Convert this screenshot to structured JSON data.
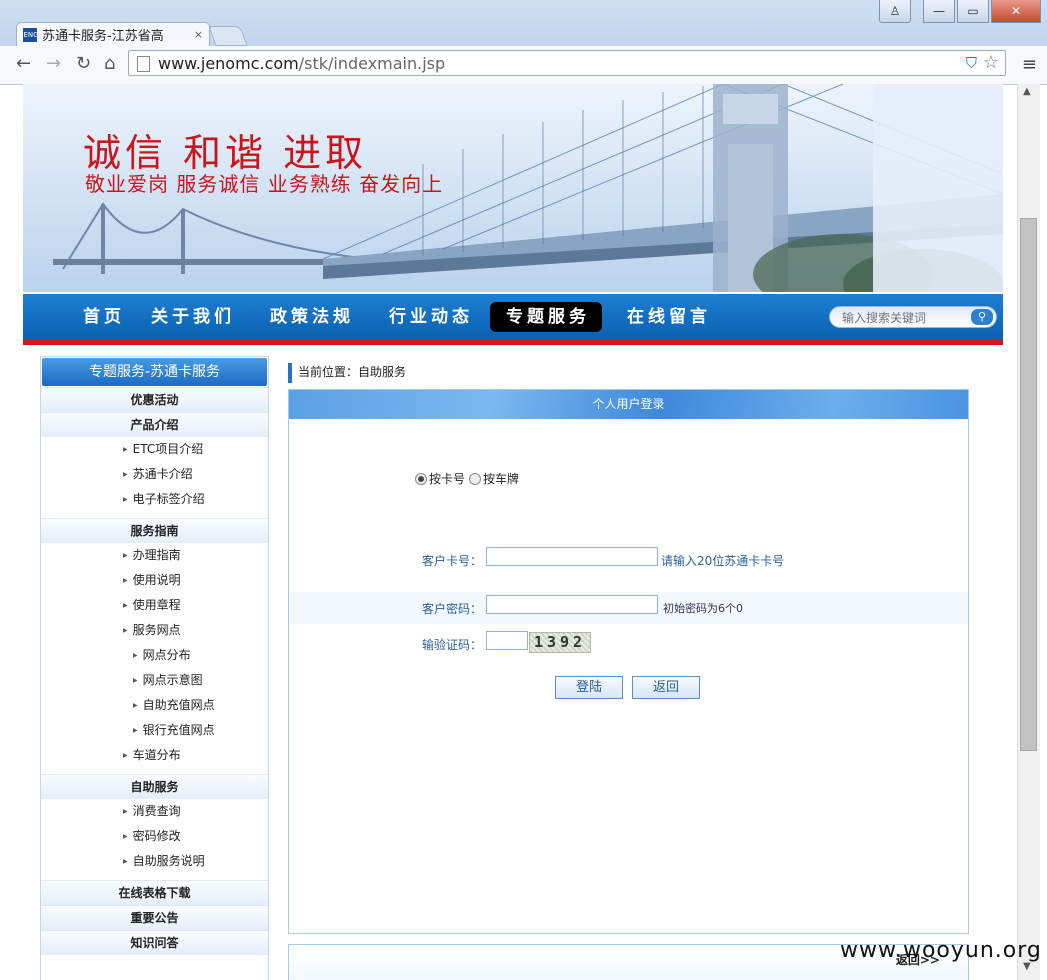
{
  "browser": {
    "tab_title": "苏通卡服务-江苏省高",
    "tab_close": "×",
    "favicon_text": "JENG",
    "url_main": "www.jenomc.com",
    "url_path": "/stk/indexmain.jsp",
    "back": "←",
    "forward": "→",
    "reload": "↻",
    "home": "⌂",
    "menu": "≡",
    "star": "☆",
    "shield": "⛉",
    "win_user": "♙",
    "win_min": "—",
    "win_max": "▭",
    "win_close": "✕"
  },
  "banner": {
    "slogan_main": "诚信  和谐  进取",
    "slogan_sub": "敬业爱岗 服务诚信  业务熟练 奋发向上"
  },
  "nav": {
    "items": [
      "首页",
      "关于我们",
      "政策法规",
      "行业动态",
      "专题服务",
      "在线留言"
    ],
    "active_index": 4,
    "search_placeholder": "输入搜索关键词",
    "search_button_icon": "⚲"
  },
  "sidebar": {
    "header": "专题服务-苏通卡服务",
    "cat_youhui": "优惠活动",
    "cat_chanpin": "产品介绍",
    "chanpin_items": [
      "ETC项目介绍",
      "苏通卡介绍",
      "电子标签介绍"
    ],
    "cat_fuwu": "服务指南",
    "fuwu_items": [
      "办理指南",
      "使用说明",
      "使用章程",
      "服务网点"
    ],
    "fuwu_sub_items": [
      "网点分布",
      "网点示意图",
      "自助充值网点",
      "银行充值网点"
    ],
    "fuwu_tail": "车道分布",
    "cat_zizhu": "自助服务",
    "zizhu_items": [
      "消费查询",
      "密码修改",
      "自助服务说明"
    ],
    "cat_biaoge": "在线表格下载",
    "cat_gonggao": "重要公告",
    "cat_wenda": "知识问答"
  },
  "content": {
    "breadcrumb": "当前位置：自助服务",
    "panel_title": "个人用户登录",
    "radio_card": "按卡号",
    "radio_plate": "按车牌",
    "radio_selected": "card",
    "card_label": "客户卡号：",
    "card_value": "",
    "card_hint": "请输入20位苏通卡卡号",
    "pwd_label": "客户密码：",
    "pwd_value": "",
    "pwd_hint": "初始密码为6个0",
    "captcha_label": "输验证码：",
    "captcha_value": "",
    "captcha_code": "1392",
    "login_button": "登陆",
    "back_button": "返回",
    "bottom_link": "返回>>"
  },
  "watermark": "www.wooyun.org",
  "colors": {
    "brand_blue": "#0a5fb0",
    "slogan_red": "#c8161d",
    "nav_red_bar": "#d6141c",
    "label_blue": "#2b5f9a"
  }
}
